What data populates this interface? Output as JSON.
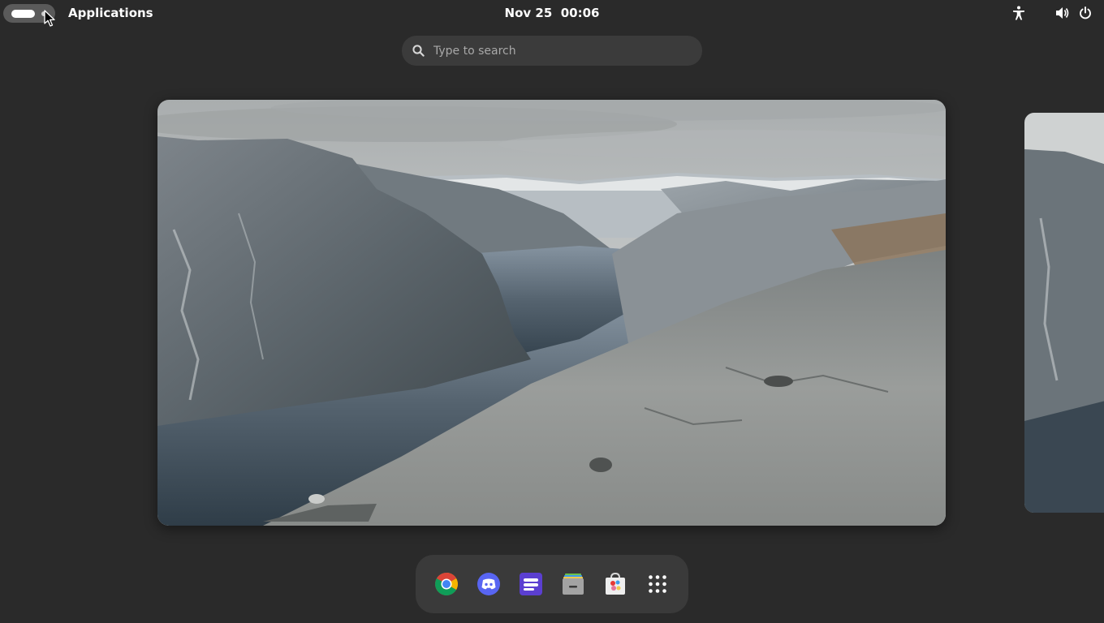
{
  "topbar": {
    "activities_icon": "activities-pill-icon",
    "app_label": "Applications",
    "date": "Nov 25",
    "time": "00:06",
    "tray_icons": [
      "accessibility-icon",
      "volume-icon",
      "power-icon"
    ]
  },
  "search": {
    "placeholder": "Type to search",
    "value": "",
    "icon": "search-icon"
  },
  "workspaces": {
    "current": "workspace-thumbnail-1",
    "next": "workspace-thumbnail-2",
    "wallpaper": "fjord-mountain-landscape"
  },
  "dash": {
    "items": [
      {
        "name": "Google Chrome",
        "icon": "chrome-icon"
      },
      {
        "name": "Discord",
        "icon": "discord-icon"
      },
      {
        "name": "Notes",
        "icon": "notes-app-icon"
      },
      {
        "name": "Files",
        "icon": "files-icon"
      },
      {
        "name": "Software",
        "icon": "software-store-icon"
      },
      {
        "name": "Show Applications",
        "icon": "app-grid-icon"
      }
    ]
  },
  "colors": {
    "background": "#2a2a2a",
    "dash_bg": "#3a3a3a",
    "search_bg": "#3b3b3b",
    "discord": "#5865f2",
    "notes": "#5b3fd1"
  }
}
